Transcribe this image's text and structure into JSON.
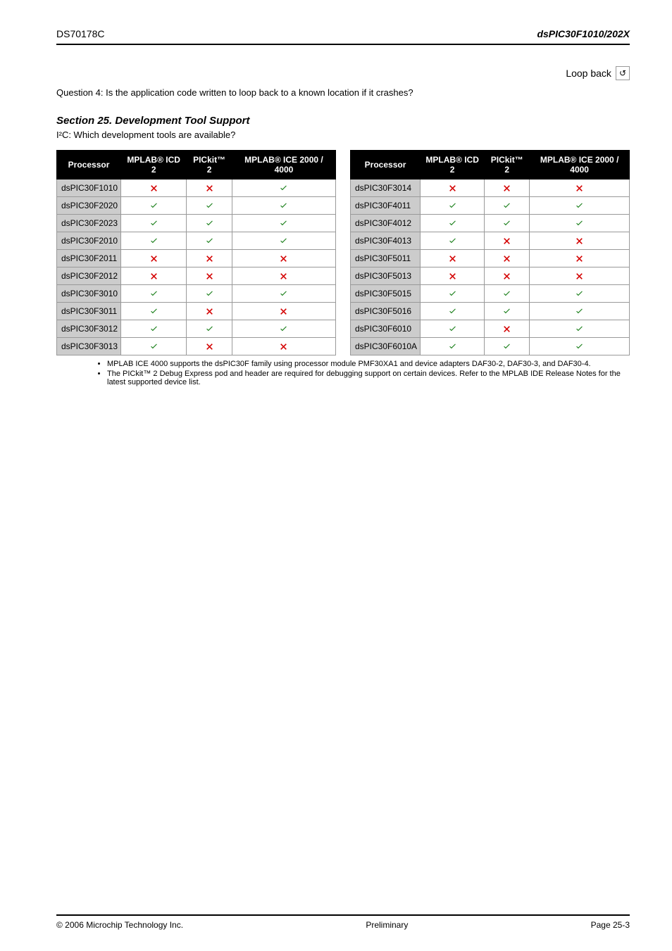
{
  "header": {
    "left": "DS70178C",
    "right": "dsPIC30F1010/202X"
  },
  "loop": {
    "text": "Question 4: Is the application code written to loop back to a known location if it crashes?",
    "link": "Loop back"
  },
  "section_title": "Section 25. Development Tool Support",
  "section_sub": "I²C: Which development tools are available?",
  "table_headers": {
    "proc": "Processor",
    "mplab": "MPLAB® ICD 2",
    "pickit2": "PICkit™ 2",
    "ice": "MPLAB® ICE 2000 / 4000"
  },
  "left_rows": [
    {
      "p": "dsPIC30F1010",
      "a": "x",
      "b": "x",
      "c": "v"
    },
    {
      "p": "dsPIC30F2020",
      "a": "v",
      "b": "v",
      "c": "v"
    },
    {
      "p": "dsPIC30F2023",
      "a": "v",
      "b": "v",
      "c": "v"
    },
    {
      "p": "dsPIC30F2010",
      "a": "v",
      "b": "v",
      "c": "v"
    },
    {
      "p": "dsPIC30F2011",
      "a": "x",
      "b": "x",
      "c": "x"
    },
    {
      "p": "dsPIC30F2012",
      "a": "x",
      "b": "x",
      "c": "x"
    },
    {
      "p": "dsPIC30F3010",
      "a": "v",
      "b": "v",
      "c": "v"
    },
    {
      "p": "dsPIC30F3011",
      "a": "v",
      "b": "x",
      "c": "x"
    },
    {
      "p": "dsPIC30F3012",
      "a": "v",
      "b": "v",
      "c": "v"
    },
    {
      "p": "dsPIC30F3013",
      "a": "v",
      "b": "x",
      "c": "x"
    }
  ],
  "right_rows": [
    {
      "p": "dsPIC30F3014",
      "a": "x",
      "b": "x",
      "c": "x"
    },
    {
      "p": "dsPIC30F4011",
      "a": "v",
      "b": "v",
      "c": "v"
    },
    {
      "p": "dsPIC30F4012",
      "a": "v",
      "b": "v",
      "c": "v"
    },
    {
      "p": "dsPIC30F4013",
      "a": "v",
      "b": "x",
      "c": "x"
    },
    {
      "p": "dsPIC30F5011",
      "a": "x",
      "b": "x",
      "c": "x"
    },
    {
      "p": "dsPIC30F5013",
      "a": "x",
      "b": "x",
      "c": "x"
    },
    {
      "p": "dsPIC30F5015",
      "a": "v",
      "b": "v",
      "c": "v"
    },
    {
      "p": "dsPIC30F5016",
      "a": "v",
      "b": "v",
      "c": "v"
    },
    {
      "p": "dsPIC30F6010",
      "a": "v",
      "b": "x",
      "c": "v"
    },
    {
      "p": "dsPIC30F6010A",
      "a": "v",
      "b": "v",
      "c": "v"
    }
  ],
  "notes": [
    "MPLAB ICE 4000 supports the dsPIC30F family using processor module PMF30XA1 and device adapters DAF30-2, DAF30-3, and DAF30-4.",
    "The PICkit™ 2 Debug Express pod and header are required for debugging support on certain devices. Refer to the MPLAB IDE Release Notes for the latest supported device list."
  ],
  "footer": {
    "left": "© 2006 Microchip Technology Inc.",
    "center": "Preliminary",
    "right": "Page 25-3"
  }
}
